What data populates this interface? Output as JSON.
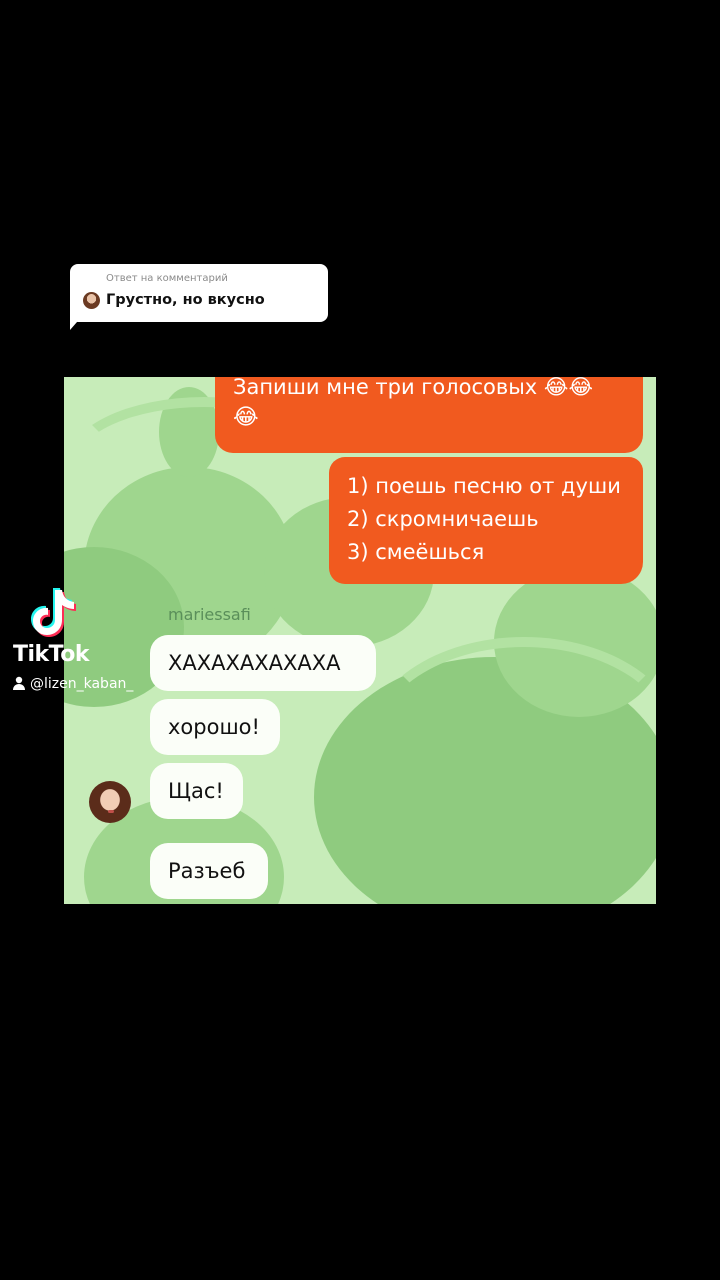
{
  "reply_sticker": {
    "header": "Ответ на комментарий",
    "comment": "Грустно, но вкусно"
  },
  "chat": {
    "outgoing_1": {
      "text": "Запиши мне три голосовых 😂😂",
      "emoji_line": "😂"
    },
    "outgoing_2": {
      "lines": [
        "1) поешь песню от души",
        "2) скромничаешь",
        "3) смеёшься"
      ]
    },
    "sender": "mariessafi",
    "incoming": [
      "ХАХАХАХАХАХА",
      "хорошо!",
      "Щас!",
      "Разъеб"
    ]
  },
  "watermark": {
    "brand": "TikTok",
    "username": "@lizen_kaban_"
  },
  "colors": {
    "outgoing_bubble": "#f15a1f",
    "chat_background": "#c7ecb9",
    "incoming_bubble": "#fbfef8"
  }
}
